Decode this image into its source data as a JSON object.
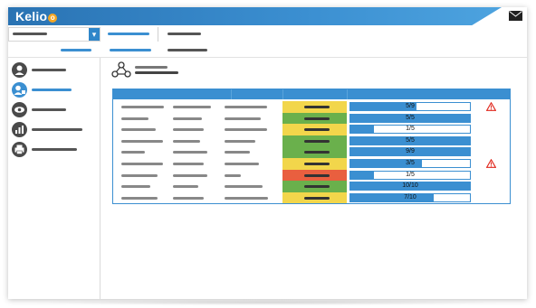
{
  "app": {
    "logo_text": "Kelio",
    "logo_badge": "o"
  },
  "colors": {
    "brand_blue": "#3b8fd1",
    "status_green": "#6ab04c",
    "status_yellow": "#f2d64b",
    "status_red": "#e95f3f",
    "warning_red": "#e0261b"
  },
  "header": {
    "mail_icon": "envelope-icon",
    "select_chevron": "▾"
  },
  "sidebar": {
    "items": [
      {
        "icon": "user-group-icon",
        "glyph": "👥",
        "active": false
      },
      {
        "icon": "user-badge-icon",
        "glyph": "👤",
        "active": true
      },
      {
        "icon": "eye-icon",
        "glyph": "👁",
        "active": false
      },
      {
        "icon": "chart-icon",
        "glyph": "▮",
        "active": false
      },
      {
        "icon": "printer-icon",
        "glyph": "▤",
        "active": false
      }
    ]
  },
  "table": {
    "rows": [
      {
        "status": "yellow",
        "progress_label": "5/9",
        "progress": 0.556,
        "warning": true
      },
      {
        "status": "green",
        "progress_label": "5/5",
        "progress": 1.0,
        "warning": false
      },
      {
        "status": "yellow",
        "progress_label": "1/5",
        "progress": 0.2,
        "warning": false
      },
      {
        "status": "green",
        "progress_label": "5/5",
        "progress": 1.0,
        "warning": false
      },
      {
        "status": "green",
        "progress_label": "9/9",
        "progress": 1.0,
        "warning": false
      },
      {
        "status": "yellow",
        "progress_label": "3/5",
        "progress": 0.6,
        "warning": true
      },
      {
        "status": "red",
        "progress_label": "1/5",
        "progress": 0.2,
        "warning": false
      },
      {
        "status": "green",
        "progress_label": "10/10",
        "progress": 1.0,
        "warning": false
      },
      {
        "status": "yellow",
        "progress_label": "7/10",
        "progress": 0.7,
        "warning": false
      }
    ]
  }
}
